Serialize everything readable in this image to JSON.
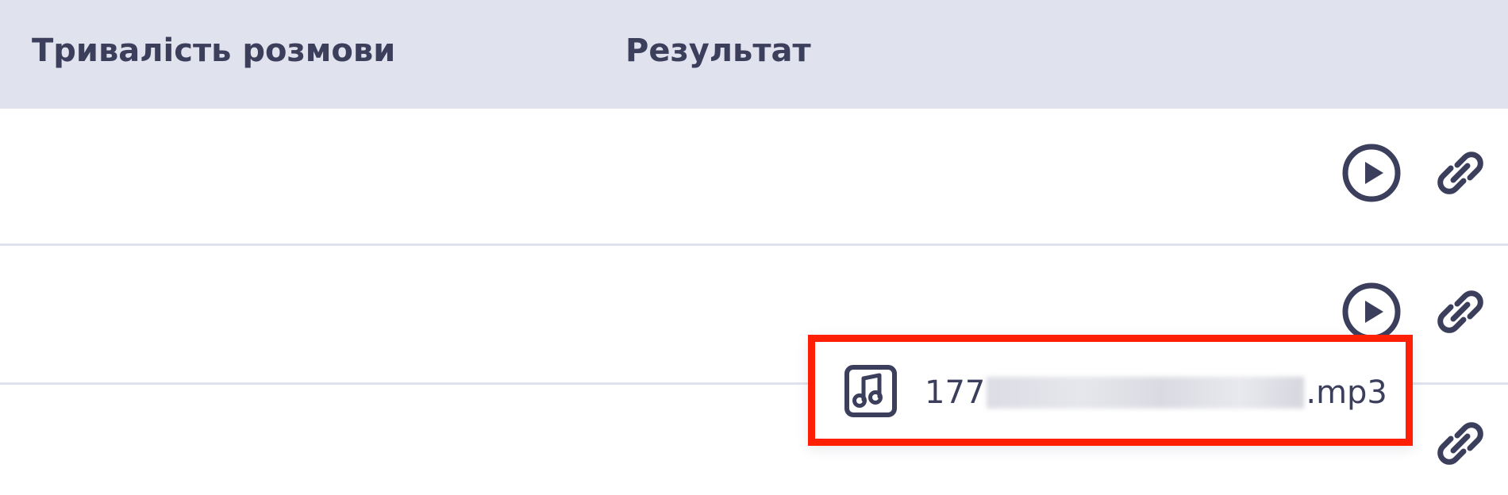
{
  "table": {
    "columns": [
      "Тривалість розмови",
      "Результат"
    ],
    "rows": [
      {
        "actions": [
          "play-icon",
          "link-icon"
        ]
      },
      {
        "actions": [
          "play-icon",
          "link-icon"
        ]
      },
      {
        "actions": [
          "link-icon"
        ]
      }
    ]
  },
  "popup": {
    "file_prefix": "177",
    "file_suffix": ".mp3",
    "icon": "music-file-icon",
    "highlight_color": "#ff1f05"
  },
  "colors": {
    "header_bg": "#e0e3ed",
    "text": "#3b3f5c",
    "divider": "#e0e3ed"
  }
}
